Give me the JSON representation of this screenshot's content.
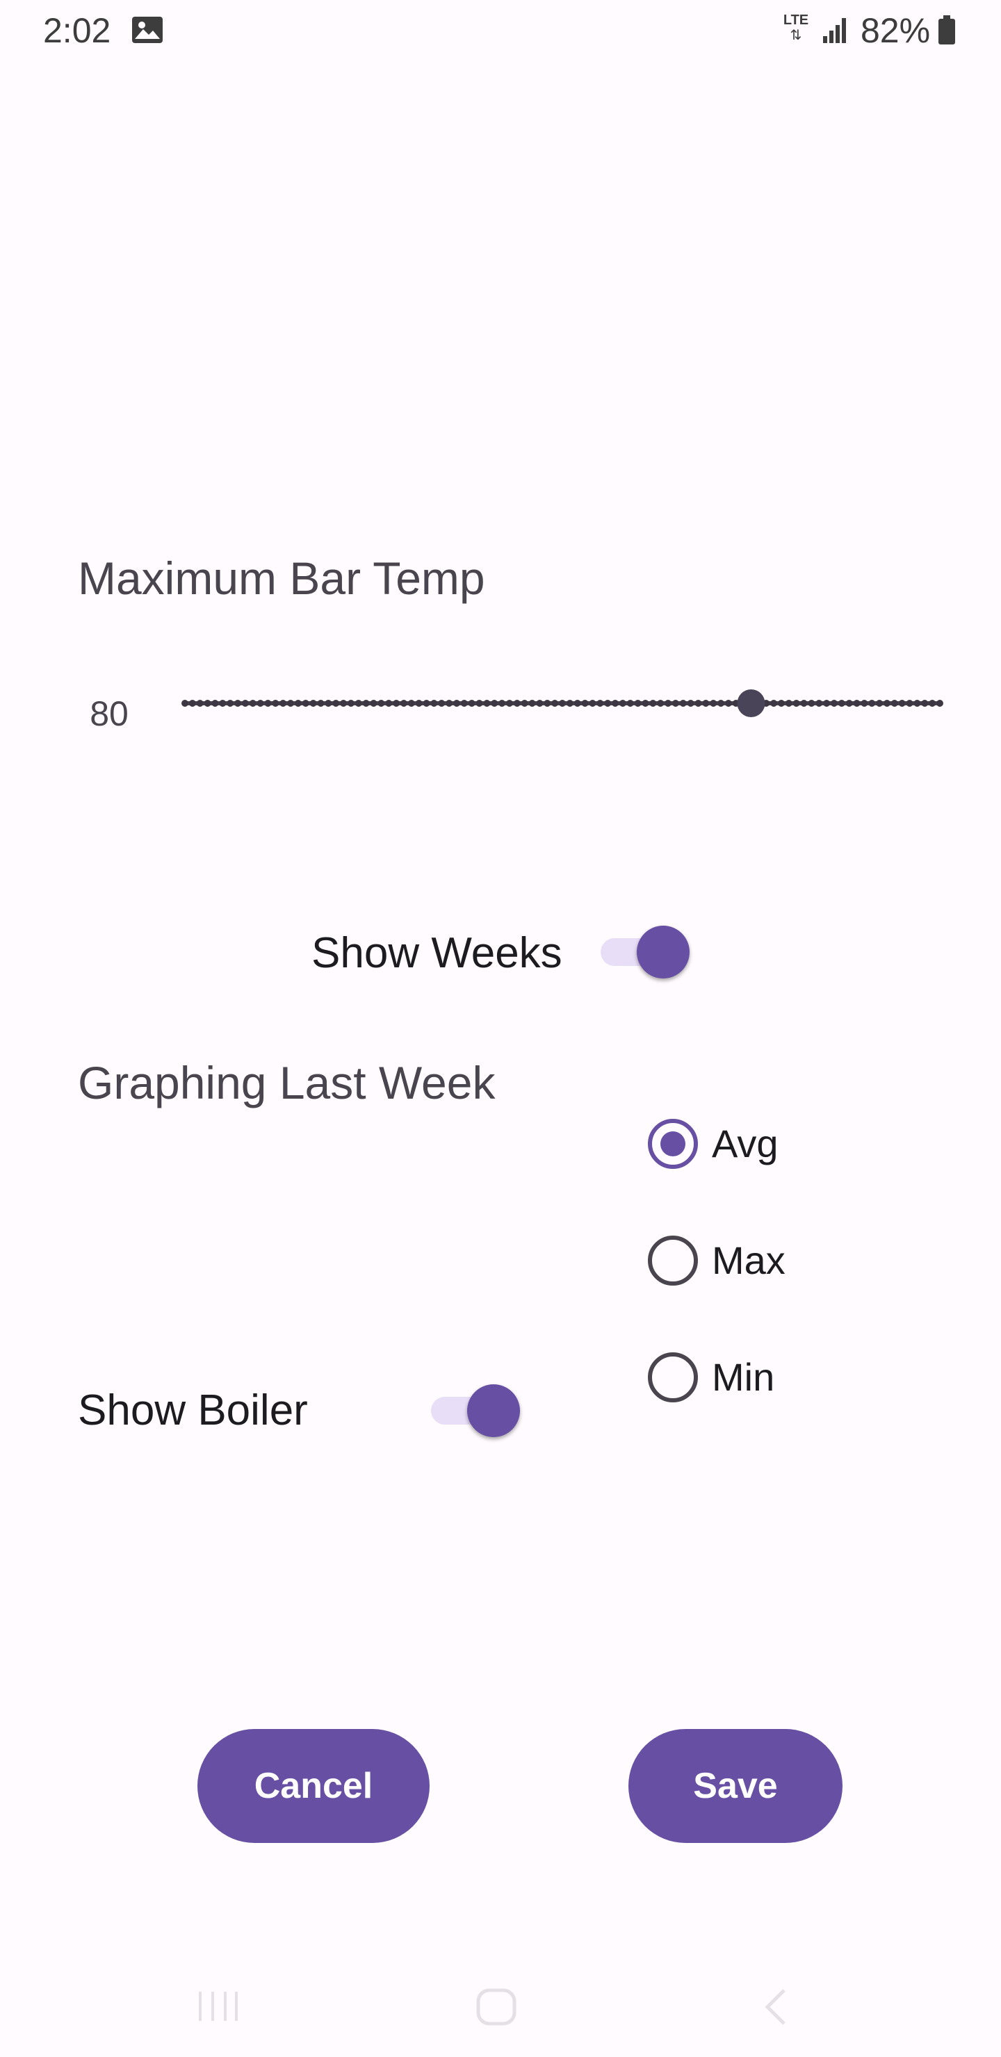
{
  "status_bar": {
    "time": "2:02",
    "network": "LTE",
    "battery": "82%",
    "icons": [
      "gallery-icon",
      "lte-icon",
      "signal-icon",
      "battery-icon"
    ]
  },
  "max_bar_temp": {
    "title": "Maximum Bar Temp",
    "value": "80",
    "slider_fraction": 0.75
  },
  "show_weeks": {
    "label": "Show Weeks",
    "on": true
  },
  "graphing": {
    "title": "Graphing Last Week",
    "options": [
      {
        "label": "Avg",
        "selected": true
      },
      {
        "label": "Max",
        "selected": false
      },
      {
        "label": "Min",
        "selected": false
      }
    ]
  },
  "show_boiler": {
    "label": "Show Boiler",
    "on": true
  },
  "actions": {
    "cancel_label": "Cancel",
    "save_label": "Save"
  },
  "nav_bar": {
    "icons": [
      "recents-icon",
      "home-icon",
      "back-icon"
    ]
  },
  "colors": {
    "accent": "#6750a4",
    "track_light": "#e8def8",
    "background": "#fffbfe"
  }
}
